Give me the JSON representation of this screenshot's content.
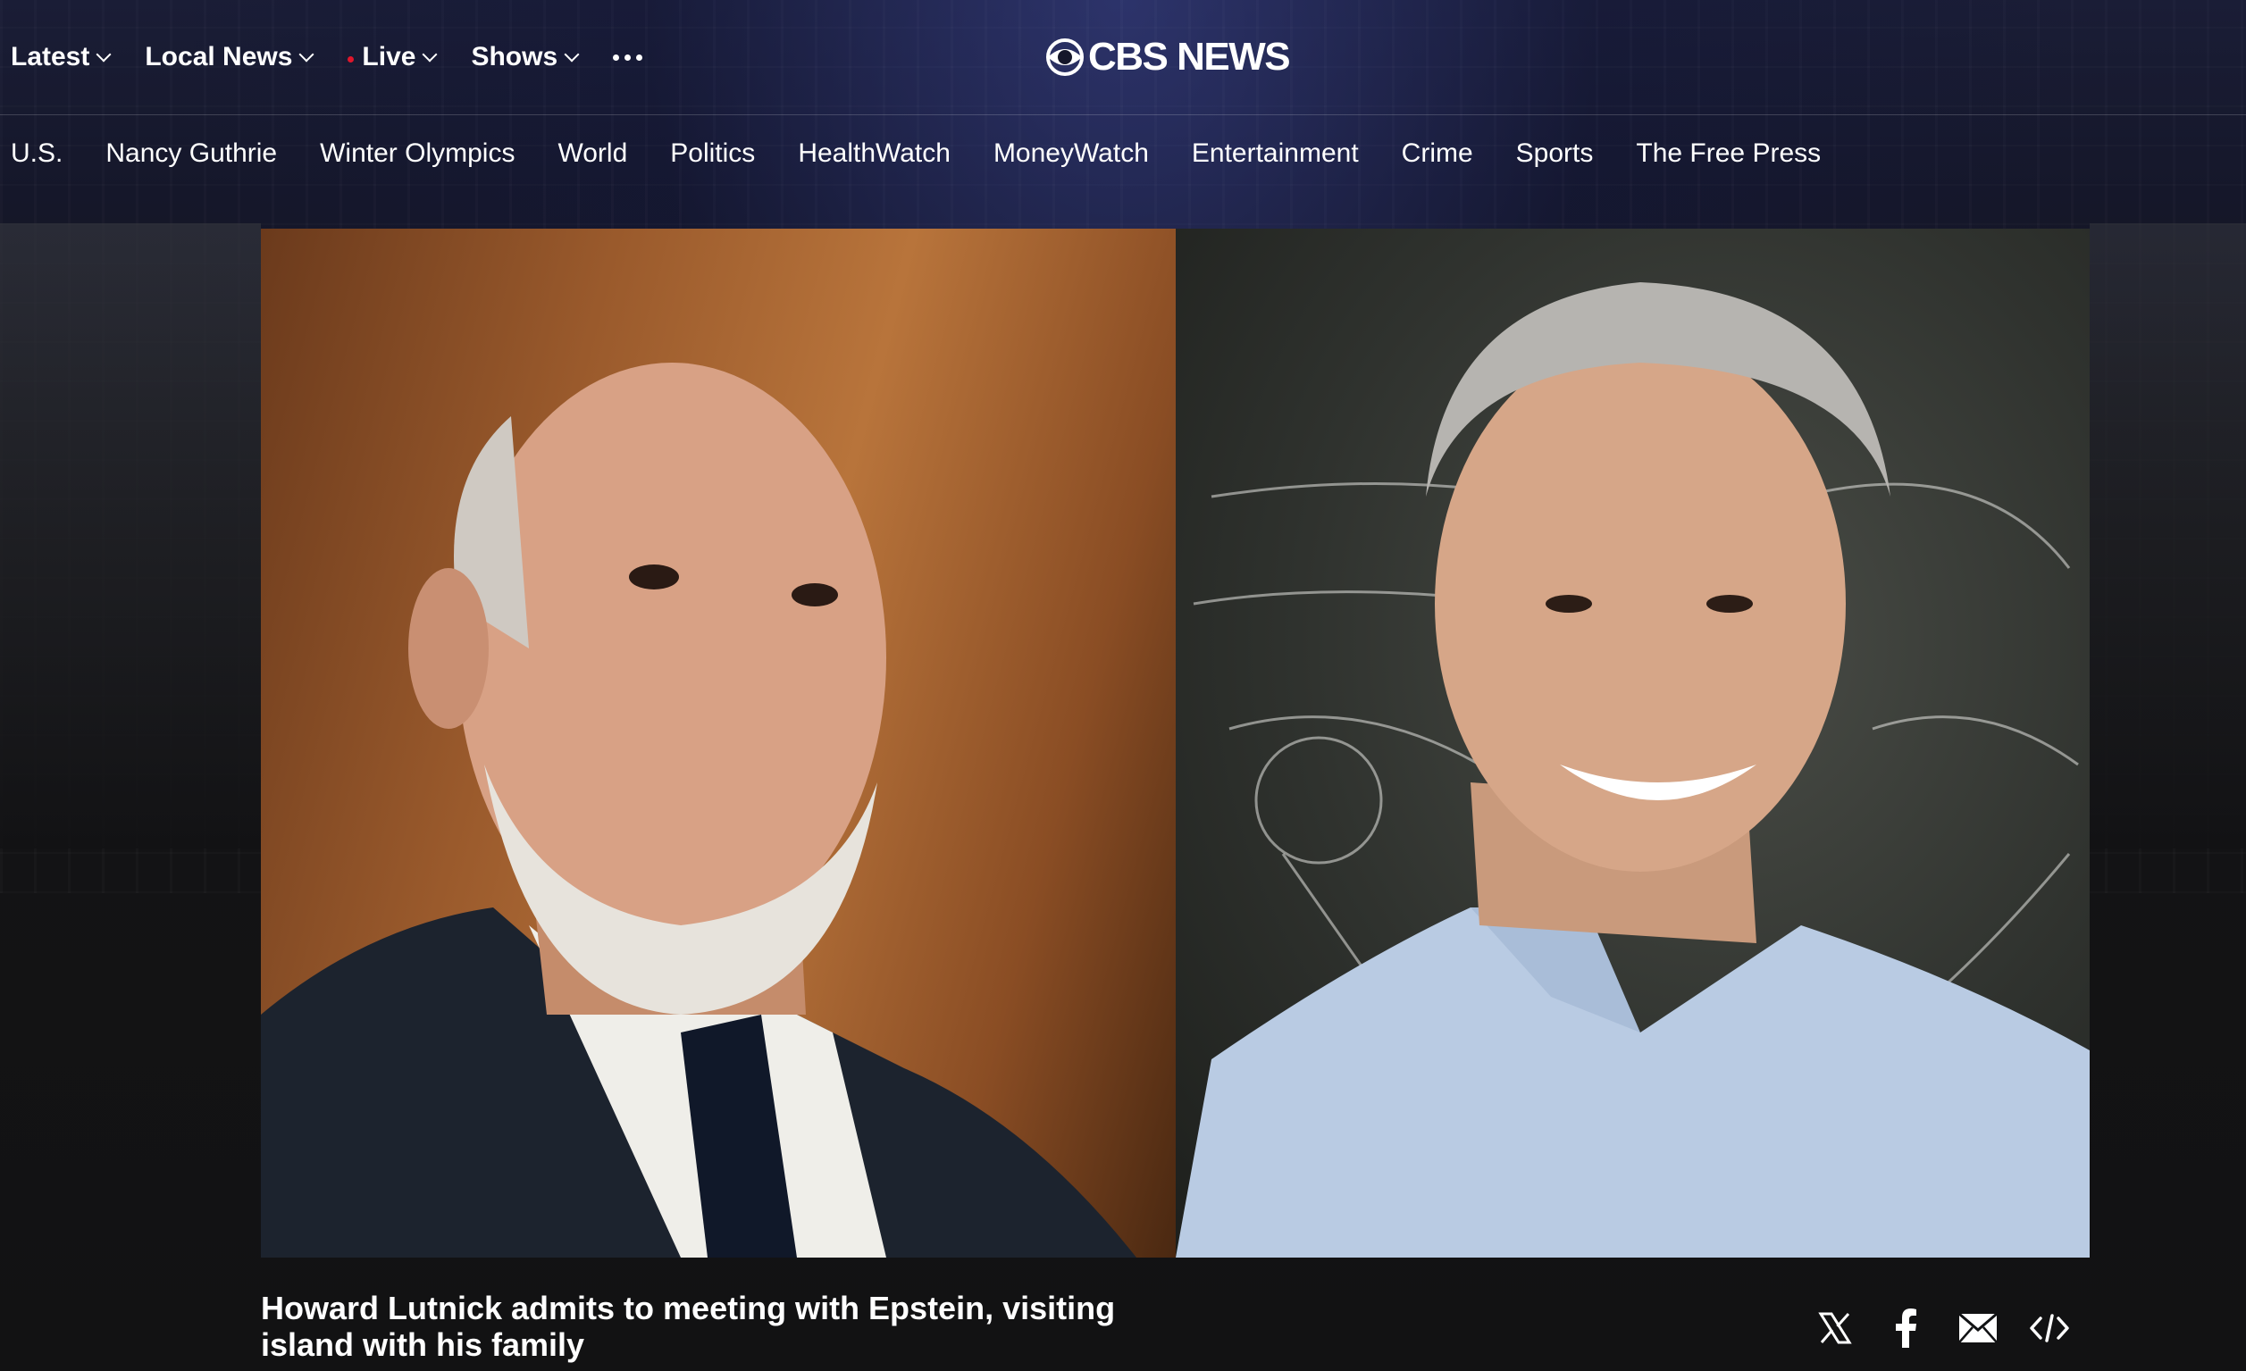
{
  "header": {
    "logo_text": "CBS NEWS",
    "top_nav": [
      {
        "label": "Latest",
        "has_dropdown": true
      },
      {
        "label": "Local News",
        "has_dropdown": true
      },
      {
        "label": "Live",
        "has_dropdown": true,
        "live_indicator": true
      },
      {
        "label": "Shows",
        "has_dropdown": true
      }
    ],
    "more_icon": "more-horizontal-icon"
  },
  "section_nav": [
    "U.S.",
    "Nancy Guthrie",
    "Winter Olympics",
    "World",
    "Politics",
    "HealthWatch",
    "MoneyWatch",
    "Entertainment",
    "Crime",
    "Sports",
    "The Free Press"
  ],
  "article": {
    "headline": "Howard Lutnick admits to meeting with Epstein, visiting island with his family",
    "images": [
      "photo-howard-lutnick",
      "photo-jeffrey-epstein"
    ]
  },
  "share": {
    "icons": [
      "x-icon",
      "facebook-icon",
      "email-icon",
      "embed-code-icon"
    ]
  },
  "colors": {
    "background": "#121213",
    "text": "#ffffff",
    "live_dot": "#e0162b"
  }
}
